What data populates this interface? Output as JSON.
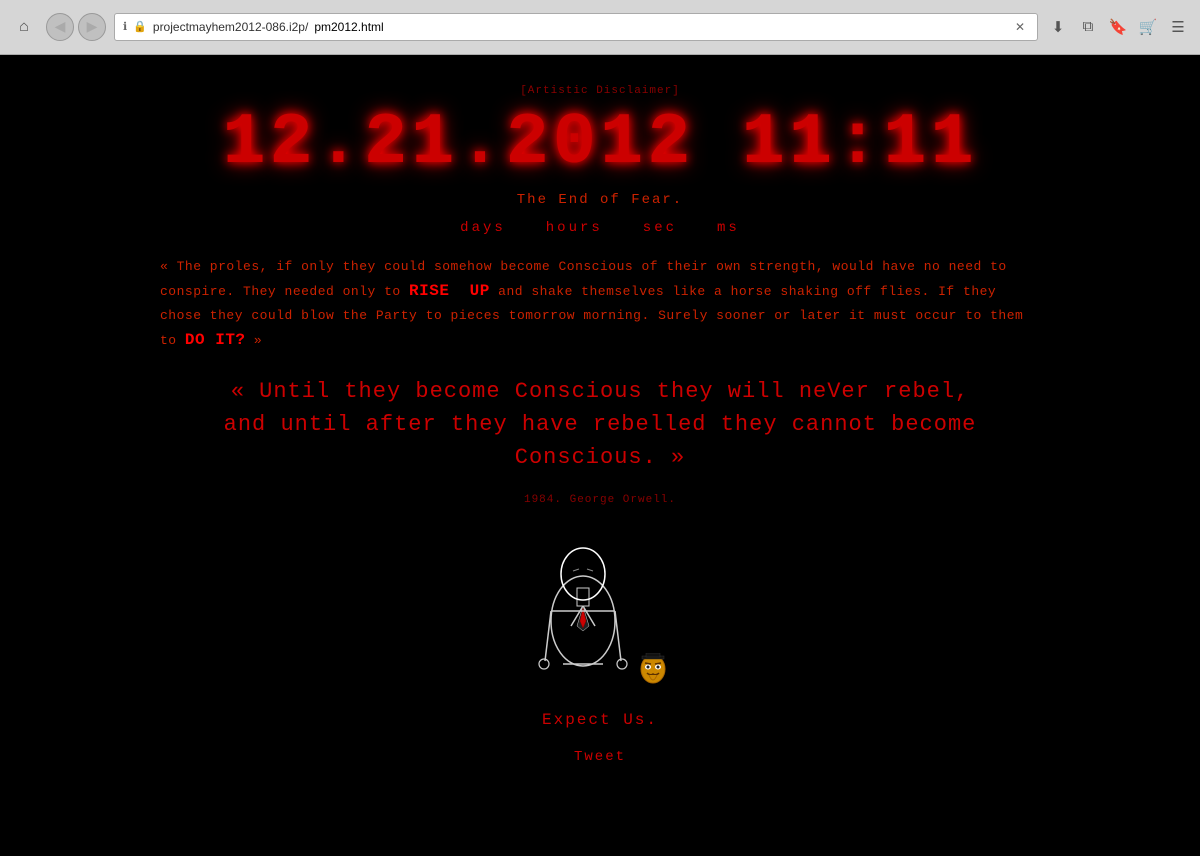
{
  "browser": {
    "back_btn": "◀",
    "forward_btn": "▶",
    "home_label": "⌂",
    "url_base": "projectmayhem2012-086.i2p/",
    "url_path": "pm2012.html",
    "close_label": "✕",
    "download_icon": "⬇",
    "window_icon": "⧉",
    "bookmark_icon": "🔖",
    "cart_icon": "🛒",
    "menu_icon": "☰"
  },
  "page": {
    "disclaimer": "[Artistic Disclaimer]",
    "clock": "12.21.2012  11:11",
    "tagline": "The End of Fear.",
    "countdown_labels": [
      "days",
      "hours",
      "sec",
      "ms"
    ],
    "paragraph": "« The proles, if only they could somehow become Conscious of their own strength, would have no need to conspire. They needed only to RISE UP and shake themselves like a horse shaking off flies. If they chose they could blow the Party to pieces tomorrow morning. Surely sooner or later it must occur to them to DO IT? »",
    "big_quote_line1": "« Until they become Conscious they will neVer rebel,",
    "big_quote_line2": "and until after they have rebelled they cannot become Conscious. »",
    "attribution": "1984. George Orwell.",
    "expect_us": "Expect Us.",
    "tweet": "Tweet"
  }
}
